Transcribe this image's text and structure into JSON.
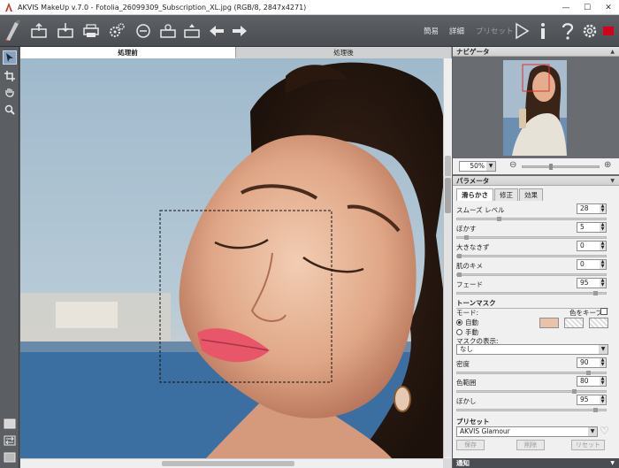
{
  "window": {
    "title": "AKVIS MakeUp v.7.0 - Fotolia_26099309_Subscription_XL.jpg (RGB/8, 2847x4271)",
    "minimize": "—",
    "maximize": "☐",
    "close": "✕"
  },
  "toolbar": {
    "mode_simple": "簡易",
    "mode_detail": "詳細",
    "preset_label": "プリセット",
    "colors": {
      "bg": "#54575c",
      "icon": "#e8e8e8",
      "accent_red": "#d0021b"
    }
  },
  "canvas": {
    "tab_before": "処理前",
    "tab_after": "処理後"
  },
  "navigator": {
    "title": "ナビゲータ",
    "zoom": "50%",
    "zoom_out": "⊖",
    "zoom_in": "⊕"
  },
  "parameters": {
    "title": "パラメータ",
    "tabs": [
      "滑らかさ",
      "修正",
      "効果"
    ],
    "smooth_level": {
      "label": "スムーズ レベル",
      "value": "28",
      "fraction": 0.28
    },
    "blur": {
      "label": "ぼかす",
      "value": "5",
      "fraction": 0.05
    },
    "size": {
      "label": "大きなきず",
      "value": "0",
      "fraction": 0.0
    },
    "skin_texture": {
      "label": "肌のキメ",
      "value": "0",
      "fraction": 0.0
    },
    "fade": {
      "label": "フェード",
      "value": "95",
      "fraction": 0.95
    },
    "tone_mask": {
      "title": "トーンマスク",
      "mode_label": "モード:",
      "keep_color_label": "色をキープ",
      "auto_label": "自動",
      "manual_label": "手動",
      "swatch_color": "#e8c3aa",
      "mask_display_label": "マスクの表示:",
      "mask_display_value": "なし",
      "density": {
        "label": "密度",
        "value": "90",
        "fraction": 0.9
      },
      "color_range": {
        "label": "色範囲",
        "value": "80",
        "fraction": 0.8
      },
      "feather": {
        "label": "ぼかし",
        "value": "95",
        "fraction": 0.95
      }
    }
  },
  "presets": {
    "title": "プリセット",
    "current": "AKVIS Glamour",
    "save": "保存",
    "delete": "削除",
    "reset": "リセット"
  },
  "notice": {
    "title": "通知"
  }
}
